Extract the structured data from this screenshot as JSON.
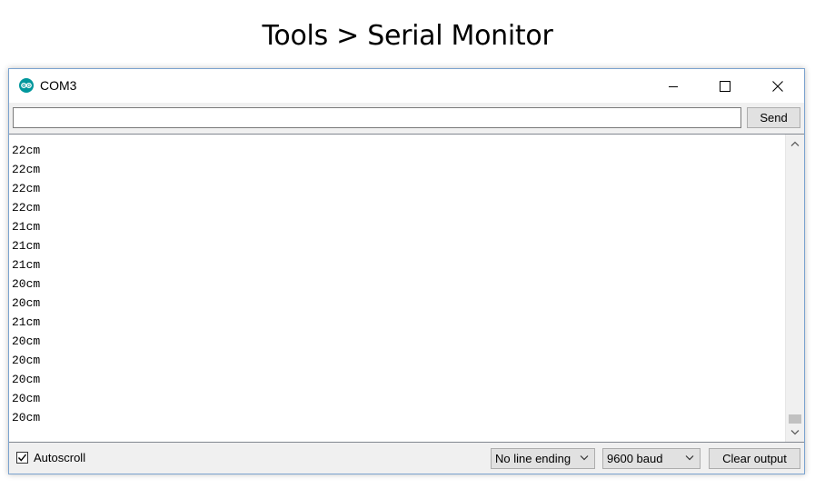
{
  "page": {
    "heading": "Tools > Serial Monitor"
  },
  "window": {
    "title": "COM3",
    "icon": "arduino-logo-icon",
    "controls": [
      "minimize-icon",
      "maximize-icon",
      "close-icon"
    ]
  },
  "send_bar": {
    "input_value": "",
    "send_label": "Send"
  },
  "output": {
    "lines": [
      "22cm",
      "22cm",
      "22cm",
      "22cm",
      "21cm",
      "21cm",
      "21cm",
      "20cm",
      "20cm",
      "21cm",
      "20cm",
      "20cm",
      "20cm",
      "20cm",
      "20cm"
    ],
    "scroll_position": 1.0
  },
  "status_bar": {
    "autoscroll_label": "Autoscroll",
    "autoscroll_checked": true,
    "line_ending": "No line ending",
    "baud_rate": "9600 baud",
    "clear_label": "Clear output"
  },
  "colors": {
    "arduino_teal": "#00979c",
    "window_border": "#7ba3cf"
  }
}
